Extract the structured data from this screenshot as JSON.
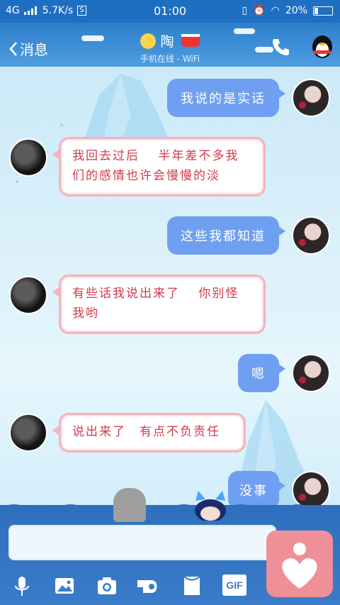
{
  "status_bar": {
    "network": "4G",
    "speed": "5.7K/s",
    "time": "01:00",
    "battery": "20%"
  },
  "header": {
    "back_label": "消息",
    "contact_name": "陶",
    "subtitle": "手机在线 - WiFi"
  },
  "messages": [
    {
      "side": "me",
      "text": "我说的是实话"
    },
    {
      "side": "other",
      "text": "我回去过后　 半年差不多我们的感情也许会慢慢的淡"
    },
    {
      "side": "me",
      "text": "这些我都知道"
    },
    {
      "side": "other",
      "text": "有些话我说出来了　 你别怪我哟"
    },
    {
      "side": "me",
      "text": "嗯"
    },
    {
      "side": "other",
      "text": "说出来了　有点不负责任"
    },
    {
      "side": "me",
      "text": "没事"
    }
  ],
  "toolbar": {
    "gif_label": "GIF",
    "icons": [
      "microphone-icon",
      "image-icon",
      "camera-icon",
      "red-packet-icon",
      "file-icon",
      "gif-icon"
    ]
  },
  "colors": {
    "header": "#2d7fcc",
    "bubble_me": "#6f9ff0",
    "bubble_other_border": "#f4b3bf",
    "bubble_other_text": "#d23a4a",
    "heart_button": "#ef8f97"
  }
}
